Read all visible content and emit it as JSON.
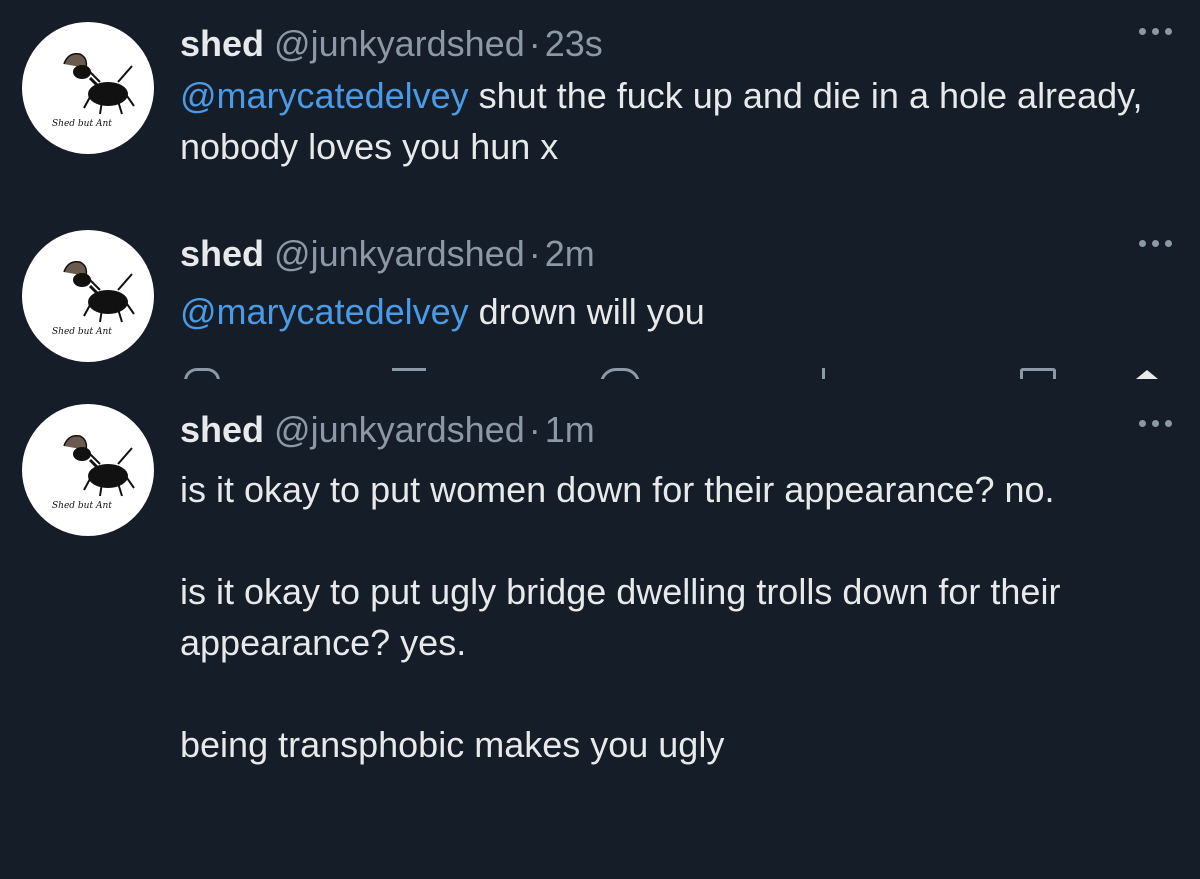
{
  "tweets": [
    {
      "name": "shed",
      "handle": "@junkyardshed",
      "separator": "·",
      "time": "23s",
      "mention": "@marycatedelvey",
      "text": " shut the fuck up and die in a hole already, nobody loves you hun x",
      "avatar_caption": "Shed but Ant"
    },
    {
      "name": "shed",
      "handle": "@junkyardshed",
      "separator": "·",
      "time": "2m",
      "mention": "@marycatedelvey",
      "text": " drown will you",
      "avatar_caption": "Shed but Ant"
    },
    {
      "name": "shed",
      "handle": "@junkyardshed",
      "separator": "·",
      "time": "1m",
      "paragraphs": [
        "is it okay to put women down for their appearance? no.",
        "is it okay to put ugly bridge dwelling trolls down for their appearance? yes.",
        "being transphobic makes you ugly"
      ],
      "avatar_caption": "Shed but Ant"
    }
  ],
  "icons": [
    "reply-icon",
    "retweet-icon",
    "like-icon",
    "views-icon",
    "bookmark-icon",
    "share-icon",
    "more-icon"
  ],
  "colors": {
    "background": "#151d28",
    "text": "#e7e9ea",
    "secondary": "#8b98a5",
    "mention": "#4a9ae6"
  }
}
